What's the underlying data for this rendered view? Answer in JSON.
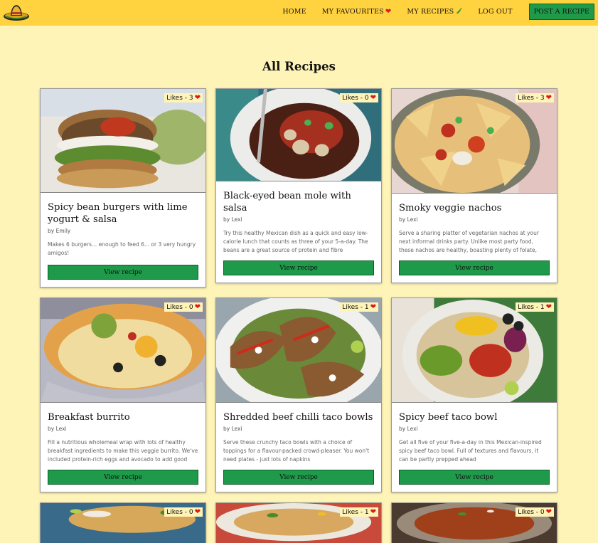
{
  "nav": {
    "links": [
      {
        "label": "HOME"
      },
      {
        "label": "MY FAVOURITES",
        "icon": "heart-icon"
      },
      {
        "label": "MY RECIPES",
        "icon": "chili-icon"
      },
      {
        "label": "LOG OUT"
      }
    ],
    "post_button": "POST A RECIPE"
  },
  "page": {
    "title": "All Recipes"
  },
  "colors": {
    "nav_bg": "#ffd23f",
    "page_bg": "#fff4b8",
    "button_green": "#1e9a4a",
    "heart_red": "#e01818"
  },
  "recipes": [
    {
      "likes": "Likes - 3",
      "title": "Spicy bean burgers with lime yogurt & salsa",
      "author": "by Emily",
      "description": "Makes 6 burgers... enough to feed 6... or 3 very hungry amigos!",
      "button": "View recipe"
    },
    {
      "likes": "Likes - 0",
      "title": "Black-eyed bean mole with salsa",
      "author": "by Lexi",
      "description": "Try this healthy Mexican dish as a quick and easy low-calorie lunch that counts as three of your 5-a-day. The beans are a great source of protein and fibre",
      "button": "View recipe"
    },
    {
      "likes": "Likes - 3",
      "title": "Smoky veggie nachos",
      "author": "by Lexi",
      "description": "Serve a sharing platter of vegetarian nachos at your next informal drinks party. Unlike most party food, these nachos are healthy, boasting plenty of folate, fibre and vitamin c",
      "button": "View recipe"
    },
    {
      "likes": "Likes - 0",
      "title": "Breakfast burrito",
      "author": "by Lexi",
      "description": "Fill a nutritious wholemeal wrap with lots of healthy breakfast ingredients to make this veggie burrito. We've included protein-rich eggs and avocado to add good fats",
      "button": "View recipe"
    },
    {
      "likes": "Likes - 1",
      "title": "Shredded beef chilli taco bowls",
      "author": "by Lexi",
      "description": "Serve these crunchy taco bowls with a choice of toppings for a flavour-packed crowd-pleaser. You won't need plates - just lots of napkins",
      "button": "View recipe"
    },
    {
      "likes": "Likes - 1",
      "title": "Spicy beef taco bowl",
      "author": "by Lexi",
      "description": "Get all five of your five-a-day in this Mexican-inspired spicy beef taco bowl. Full of textures and flavours, it can be partly prepped ahead",
      "button": "View recipe"
    },
    {
      "likes": "Likes - 0"
    },
    {
      "likes": "Likes - 1"
    },
    {
      "likes": "Likes - 0"
    }
  ]
}
